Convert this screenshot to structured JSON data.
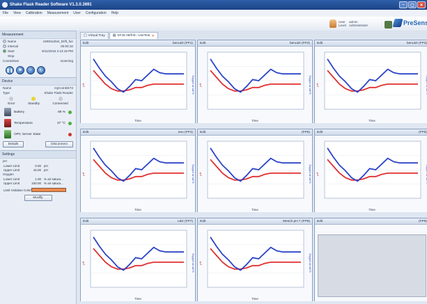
{
  "window": {
    "title": "Shake Flask Reader Software V1.3.0.3691",
    "controls": [
      "–",
      "▢",
      "✕"
    ]
  },
  "menu": [
    "File",
    "View",
    "Calibration",
    "Measurement",
    "User",
    "Configuration",
    "Help"
  ],
  "user": {
    "user_label": "User",
    "user_value": "admin",
    "level_label": "Level",
    "level_value": "Administrator"
  },
  "brand": {
    "name": "PreSens"
  },
  "measurement": {
    "heading": "Measurement",
    "name_label": "Name",
    "name_value": "160811shel_Drift_fun",
    "interval_label": "Interval",
    "interval_value": "00:00:10",
    "start_label": "Start",
    "start_value": "8/11/2016 2:13:19 PM",
    "stop_label": "Stop",
    "stop_value": "",
    "countdown_label": "Countdown",
    "countdown_value": "scanning",
    "buttons": [
      "pause",
      "stop",
      "cycle",
      "refresh"
    ]
  },
  "device": {
    "heading": "Device",
    "name_label": "Name",
    "name_value": "myComEE72",
    "type_label": "Type",
    "type_value": "Shake Flask Reader",
    "status": [
      {
        "label": "Error",
        "color": "#c6ccd6"
      },
      {
        "label": "Standby",
        "color": "#e8d43a"
      },
      {
        "label": "Connected",
        "color": "#c6ccd6"
      }
    ],
    "battery_label": "Battery",
    "battery_value": "89 %",
    "temp_label": "Temperature",
    "temp_value": "37 °C",
    "opc_label": "OPC Server State",
    "details_label": "Details",
    "disconnect_label": "Disconnect"
  },
  "settings": {
    "heading": "Settings",
    "ph_heading": "pH",
    "ph_lower_label": "Lower Limit",
    "ph_lower_value": "0.00",
    "ph_lower_unit": "pH",
    "ph_upper_label": "Upper Limit",
    "ph_upper_value": "15.00",
    "ph_upper_unit": "pH",
    "ox_heading": "Oxygen",
    "ox_lower_label": "Lower Limit",
    "ox_lower_value": "1.00",
    "ox_lower_unit": "% air satura...",
    "ox_upper_label": "Upper Limit",
    "ox_upper_value": "100.00",
    "ox_upper_unit": "% air satura...",
    "violation_label": "Limit Violation Color",
    "violation_color": "#f08a4b",
    "modify_label": "Modify"
  },
  "tabs": [
    {
      "label": "Virtual Tray"
    },
    {
      "label": "SF45 06/fnfc: UseTest"
    }
  ],
  "panels": [
    {
      "edit": "Edit",
      "title": "benutzt (FP1)"
    },
    {
      "edit": "Edit",
      "title": "benutzt (FP2)"
    },
    {
      "edit": "Edit",
      "title": "benutzt (FP3)"
    },
    {
      "edit": "Edit",
      "title": "neu (FP4)"
    },
    {
      "edit": "Edit",
      "title": "(FP5)"
    },
    {
      "edit": "Edit",
      "title": "(FP6)"
    },
    {
      "edit": "Edit",
      "title": "LB2 (FP7)"
    },
    {
      "edit": "Edit",
      "title": "Mesch pH 7 (FP8)"
    },
    {
      "edit": "Edit",
      "title": "(FP9)"
    }
  ],
  "chart_axis": {
    "xlabel": "Time",
    "ylabel_left": "pH",
    "ylabel_right": "Oxygen air sat %"
  },
  "chart_data": [
    {
      "type": "line",
      "panel": "benutzt (FP1)",
      "series": [
        {
          "name": "Oxygen",
          "color": "#2b44c8",
          "y": [
            88,
            72,
            58,
            48,
            36,
            30,
            40,
            52,
            50,
            60,
            70,
            64,
            62,
            62,
            62,
            62
          ]
        },
        {
          "name": "pH",
          "color": "#e03030",
          "y": [
            7.2,
            6.9,
            6.6,
            6.4,
            6.3,
            6.3,
            6.35,
            6.45,
            6.45,
            6.55,
            6.6,
            6.6,
            6.6,
            6.6,
            6.6,
            6.6
          ]
        }
      ]
    }
  ],
  "colors": {
    "oxygen": "#2b44c8",
    "ph": "#e03030"
  }
}
